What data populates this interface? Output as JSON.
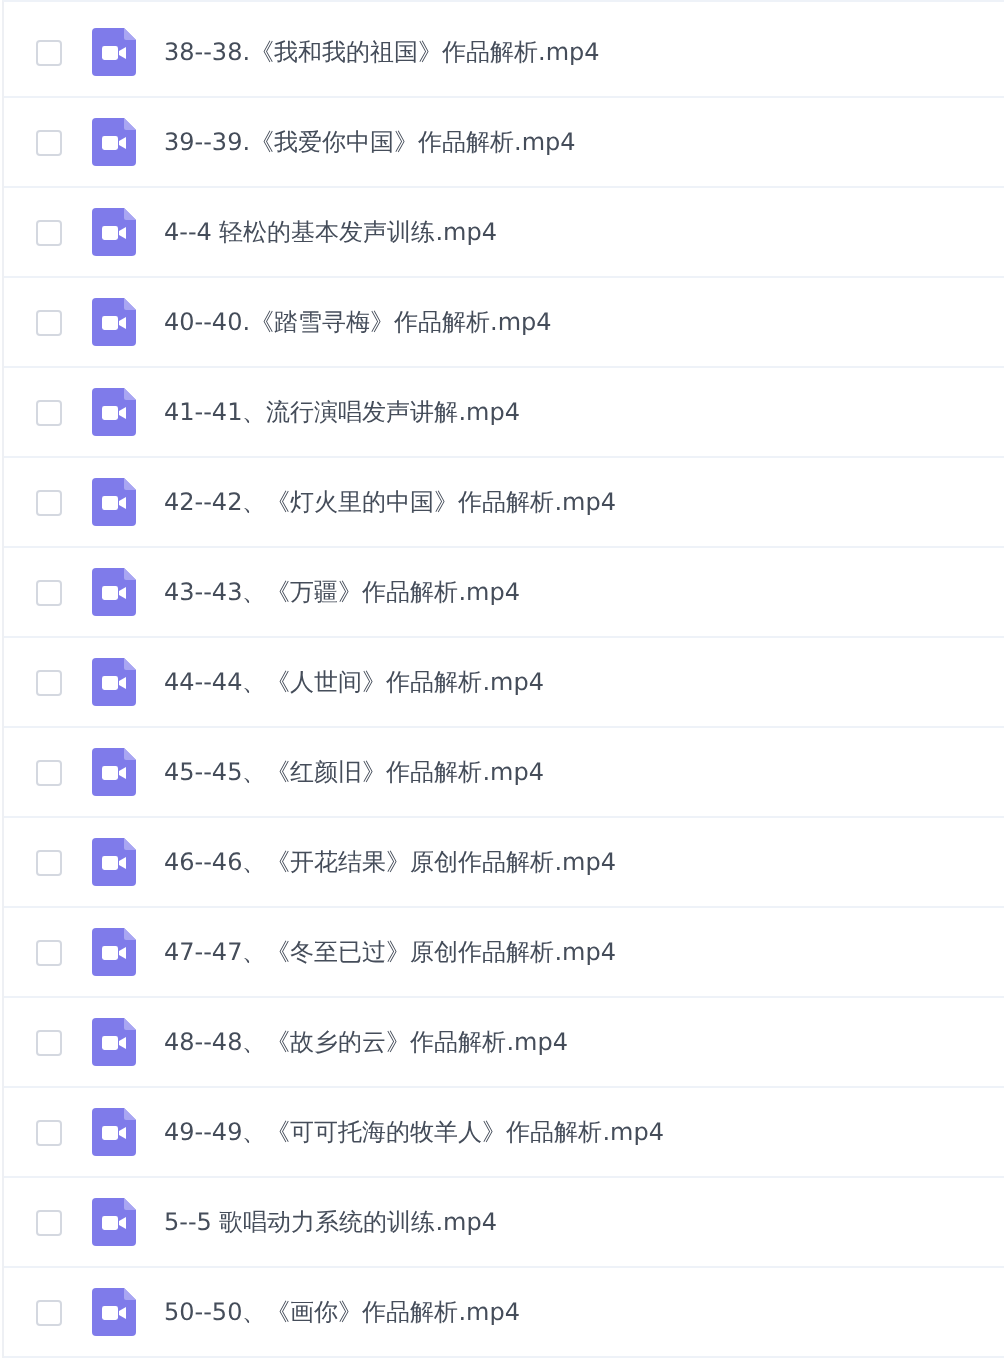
{
  "files": [
    {
      "name": "38--38.《我和我的祖国》作品解析.mp4",
      "checked": false
    },
    {
      "name": "39--39.《我爱你中国》作品解析.mp4",
      "checked": false
    },
    {
      "name": "4--4 轻松的基本发声训练.mp4",
      "checked": false
    },
    {
      "name": "40--40.《踏雪寻梅》作品解析.mp4",
      "checked": false
    },
    {
      "name": "41--41、流行演唱发声讲解.mp4",
      "checked": false
    },
    {
      "name": "42--42、《灯火里的中国》作品解析.mp4",
      "checked": false
    },
    {
      "name": "43--43、《万疆》作品解析.mp4",
      "checked": false
    },
    {
      "name": "44--44、《人世间》作品解析.mp4",
      "checked": false
    },
    {
      "name": "45--45、《红颜旧》作品解析.mp4",
      "checked": false
    },
    {
      "name": "46--46、《开花结果》原创作品解析.mp4",
      "checked": false
    },
    {
      "name": "47--47、《冬至已过》原创作品解析.mp4",
      "checked": false
    },
    {
      "name": "48--48、《故乡的云》作品解析.mp4",
      "checked": false
    },
    {
      "name": "49--49、《可可托海的牧羊人》作品解析.mp4",
      "checked": false
    },
    {
      "name": "5--5 歌唱动力系统的训练.mp4",
      "checked": false
    },
    {
      "name": "50--50、《画你》作品解析.mp4",
      "checked": false
    }
  ]
}
